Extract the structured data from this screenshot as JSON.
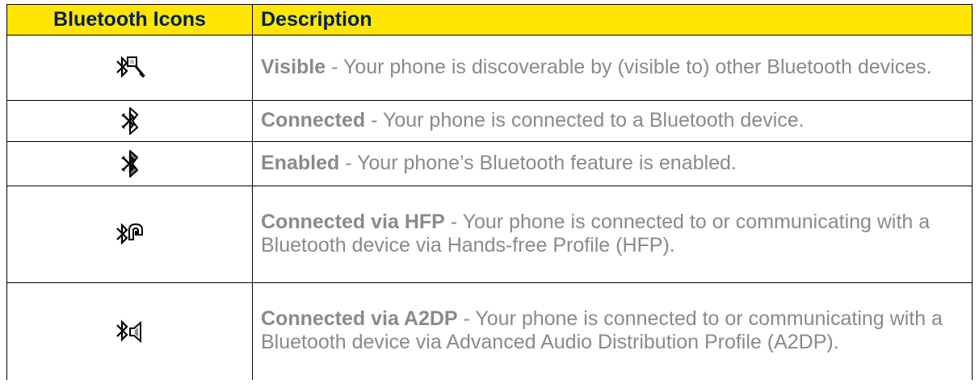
{
  "table": {
    "headers": {
      "icons": "Bluetooth Icons",
      "description": "Description"
    },
    "rows": [
      {
        "icon": "bluetooth-visible-icon",
        "term": "Visible",
        "text": " - Your phone is discoverable by (visible to) other Bluetooth devices."
      },
      {
        "icon": "bluetooth-connected-icon",
        "term": "Connected",
        "text": " - Your phone is connected to a Bluetooth device."
      },
      {
        "icon": "bluetooth-enabled-icon",
        "term": "Enabled",
        "text": " - Your phone’s Bluetooth feature is enabled."
      },
      {
        "icon": "bluetooth-hfp-icon",
        "term": "Connected via HFP",
        "text": " - Your phone is connected to or communicating with a Bluetooth device via Hands-free Profile (HFP)."
      },
      {
        "icon": "bluetooth-a2dp-icon",
        "term": "Connected via A2DP",
        "text": " - Your phone is connected to or communicating with a Bluetooth device via Advanced Audio Distribution Profile (A2DP)."
      }
    ]
  },
  "colors": {
    "header_background": "#ffe600",
    "header_text": "#00205b",
    "body_text": "#8a8a8a",
    "border": "#000000"
  }
}
